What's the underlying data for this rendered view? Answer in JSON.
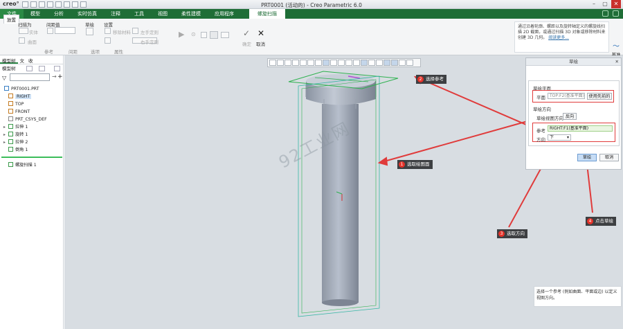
{
  "titlebar": {
    "logo": "creo°",
    "title": "PRT0001 (活动的) - Creo Parametric 6.0",
    "controls": [
      "–",
      "▢",
      "✕"
    ]
  },
  "tabs": {
    "items": [
      "文件",
      "模型",
      "分析",
      "实时仿真",
      "注释",
      "工具",
      "视图",
      "柔性建模",
      "应用程序"
    ],
    "active": "螺旋扫描"
  },
  "ribbon": {
    "sweep_as": "扫描为",
    "solid": "实体",
    "surface": "曲面",
    "pitch": "间距值",
    "section": "草绘",
    "settings": "设置",
    "remove_material": "移除材料",
    "left_hand": "左手定则",
    "right_hand": "右手定则",
    "preview_icons": [
      "▶",
      "⊙",
      "☐",
      "☐",
      "☐"
    ],
    "ok": "确定",
    "cancel": "取消",
    "group_labels": [
      "参考",
      "间距",
      "选项",
      "属性"
    ],
    "info_text": "通过沿着轮廓、螺距以及旋转轴定义的螺旋线扫描 2D 截面，或通过扫描 3D 对象或移除材料来创建 3D 几何。",
    "info_link": "阅读更多...",
    "datum": "基准"
  },
  "leftpanel": {
    "tabs": [
      "模型树",
      "文",
      "收"
    ],
    "toolbar_label": "模型树",
    "tree": [
      {
        "label": "PRT0001.PRT",
        "icon": "part-icon",
        "level": 0
      },
      {
        "label": "RIGHT",
        "icon": "datum-plane-icon",
        "level": 1,
        "selected": true
      },
      {
        "label": "TOP",
        "icon": "datum-plane-icon",
        "level": 1
      },
      {
        "label": "FRONT",
        "icon": "datum-plane-icon",
        "level": 1
      },
      {
        "label": "PRT_CSYS_DEF",
        "icon": "csys-icon",
        "level": 1
      },
      {
        "label": "拉伸 1",
        "icon": "extrude-icon",
        "level": 1,
        "expand": true
      },
      {
        "label": "旋转 1",
        "icon": "revolve-icon",
        "level": 1,
        "expand": true
      },
      {
        "label": "拉伸 2",
        "icon": "extrude-icon",
        "level": 1,
        "expand": true
      },
      {
        "label": "倒角 1",
        "icon": "chamfer-icon",
        "level": 1
      },
      {
        "label": "螺旋扫描 1",
        "icon": "helical-sweep-icon",
        "level": 1
      }
    ]
  },
  "watermark": "92工业网",
  "dialog": {
    "title": "草绘",
    "tab": "放置",
    "sketch_plane": "草绘平面",
    "plane_label": "平面",
    "plane_value": "TOP:F2(基准平面)",
    "use_previous": "使用先前的",
    "sketch_orient": "草绘方向",
    "view_dir_label": "草绘视图方向",
    "flip": "反向",
    "ref_label": "参考",
    "ref_value": "RIGHT:F1(基准平面)",
    "dir_label": "方向",
    "dir_value": "下",
    "ok": "草绘",
    "cancel": "取消"
  },
  "tooltip": "选择一个参考 (例如曲面、平面或边) 以定义视图方向。",
  "callouts": [
    {
      "num": "1",
      "text": "选取绘图面"
    },
    {
      "num": "2",
      "text": "选择参考"
    },
    {
      "num": "3",
      "text": "选取方向"
    },
    {
      "num": "4",
      "text": "点击草绘"
    }
  ],
  "colors": {
    "ribbon_green": "#1f6e37",
    "annotation_red": "#e03b3b",
    "callout_bg": "#3d3f42"
  }
}
